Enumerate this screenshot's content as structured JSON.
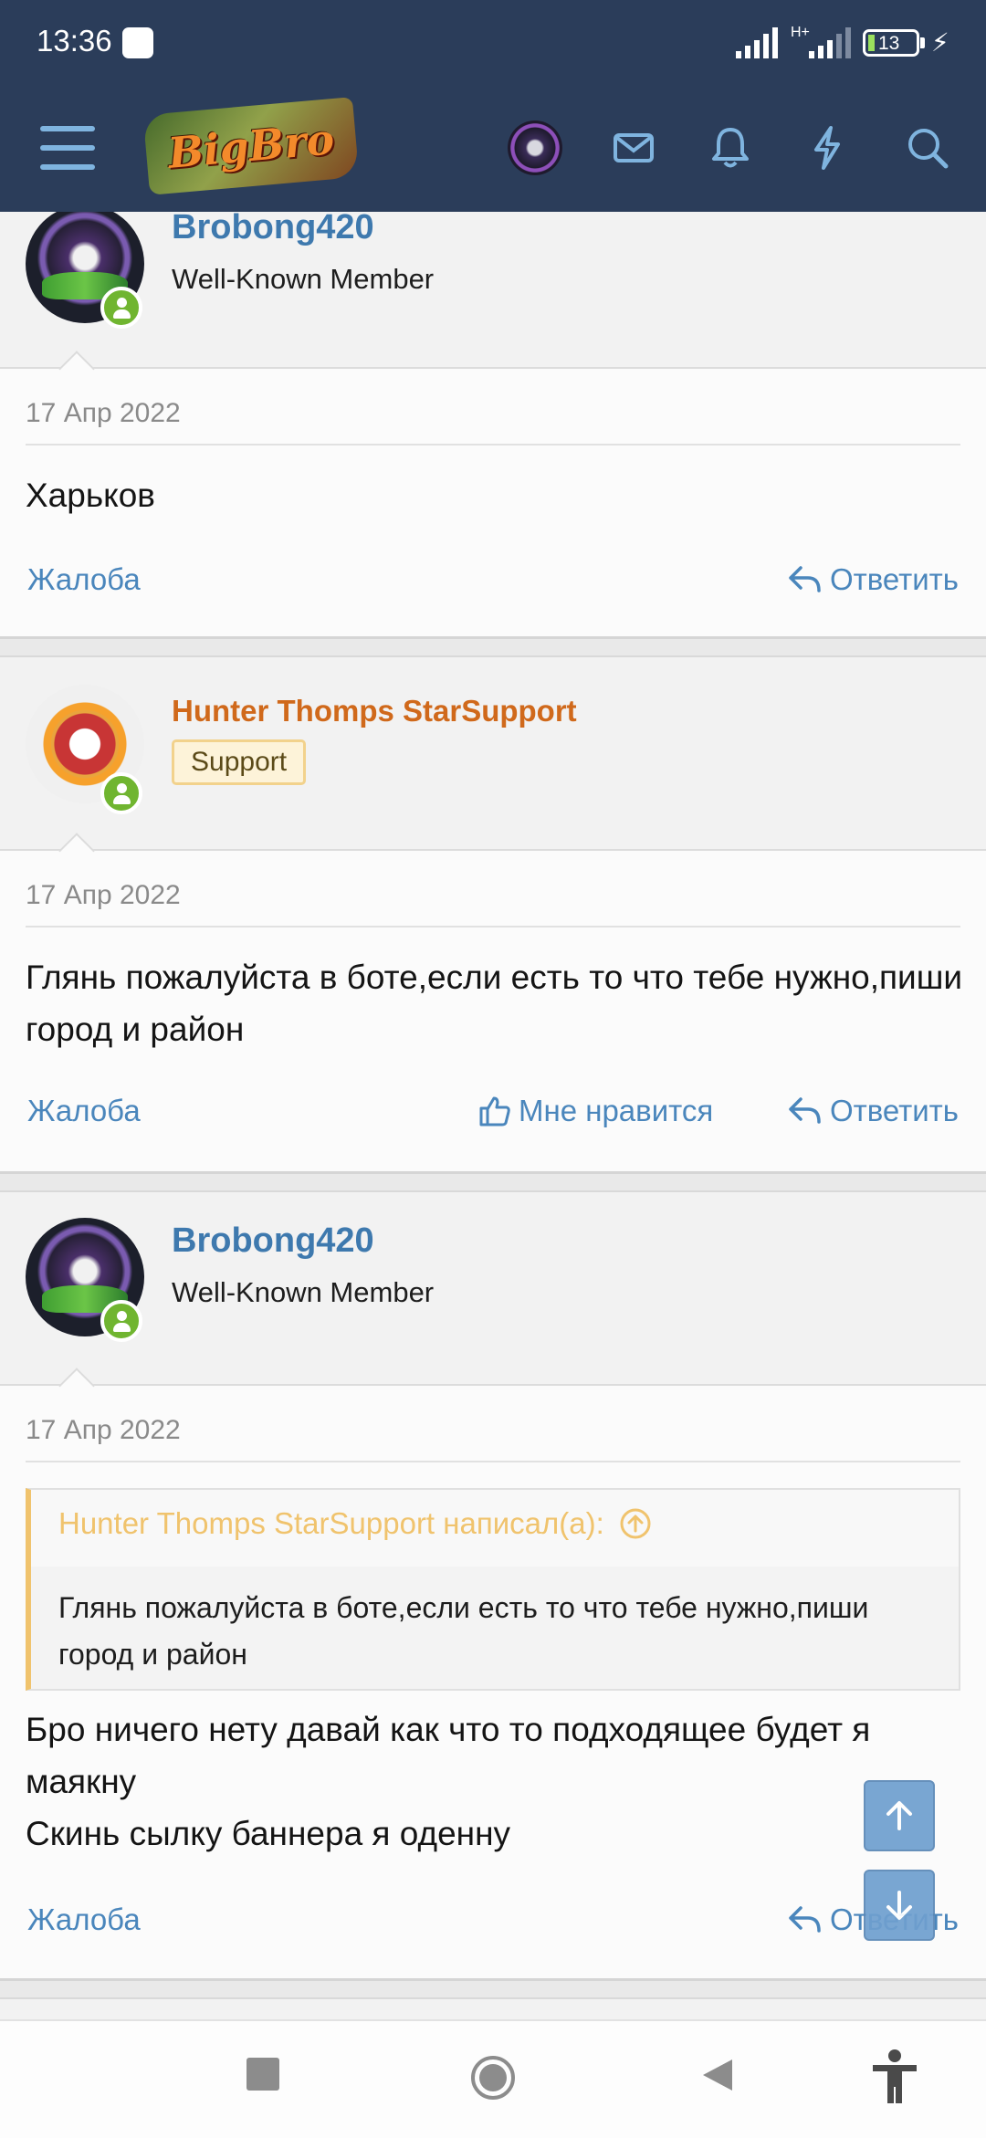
{
  "status_bar": {
    "time": "13:36",
    "network": "H+",
    "battery": "13"
  },
  "header": {
    "logo_text": "BigBro"
  },
  "posts": [
    {
      "username": "Brobong420",
      "user_title": "Well-Known Member",
      "date": "17 Апр 2022",
      "message": "Харьков",
      "report_label": "Жалоба",
      "reply_label": "Ответить"
    },
    {
      "username": "Hunter Thomps StarSupport",
      "user_badge": "Support",
      "date": "17 Апр 2022",
      "message": "Глянь пожалуйста в боте,если есть то что тебе нужно,пиши город и район",
      "report_label": "Жалоба",
      "like_label": "Мне нравится",
      "reply_label": "Ответить"
    },
    {
      "username": "Brobong420",
      "user_title": "Well-Known Member",
      "date": "17 Апр 2022",
      "quote_author": "Hunter Thomps StarSupport написал(а):",
      "quote_text": "Глянь пожалуйста в боте,если есть то что тебе нужно,пиши город и район",
      "message_lines": [
        "Бро ничего нету давай как что то подходящее будет я маякну",
        "Скинь сылку баннера я оденну"
      ],
      "report_label": "Жалоба",
      "reply_label": "Ответить"
    }
  ],
  "colors": {
    "header_bg": "#2b3d5a",
    "link": "#4a86bc",
    "username": "#3e79ae",
    "support_name": "#d0691b",
    "quote_accent": "#f0c36d",
    "online": "#70b530"
  }
}
